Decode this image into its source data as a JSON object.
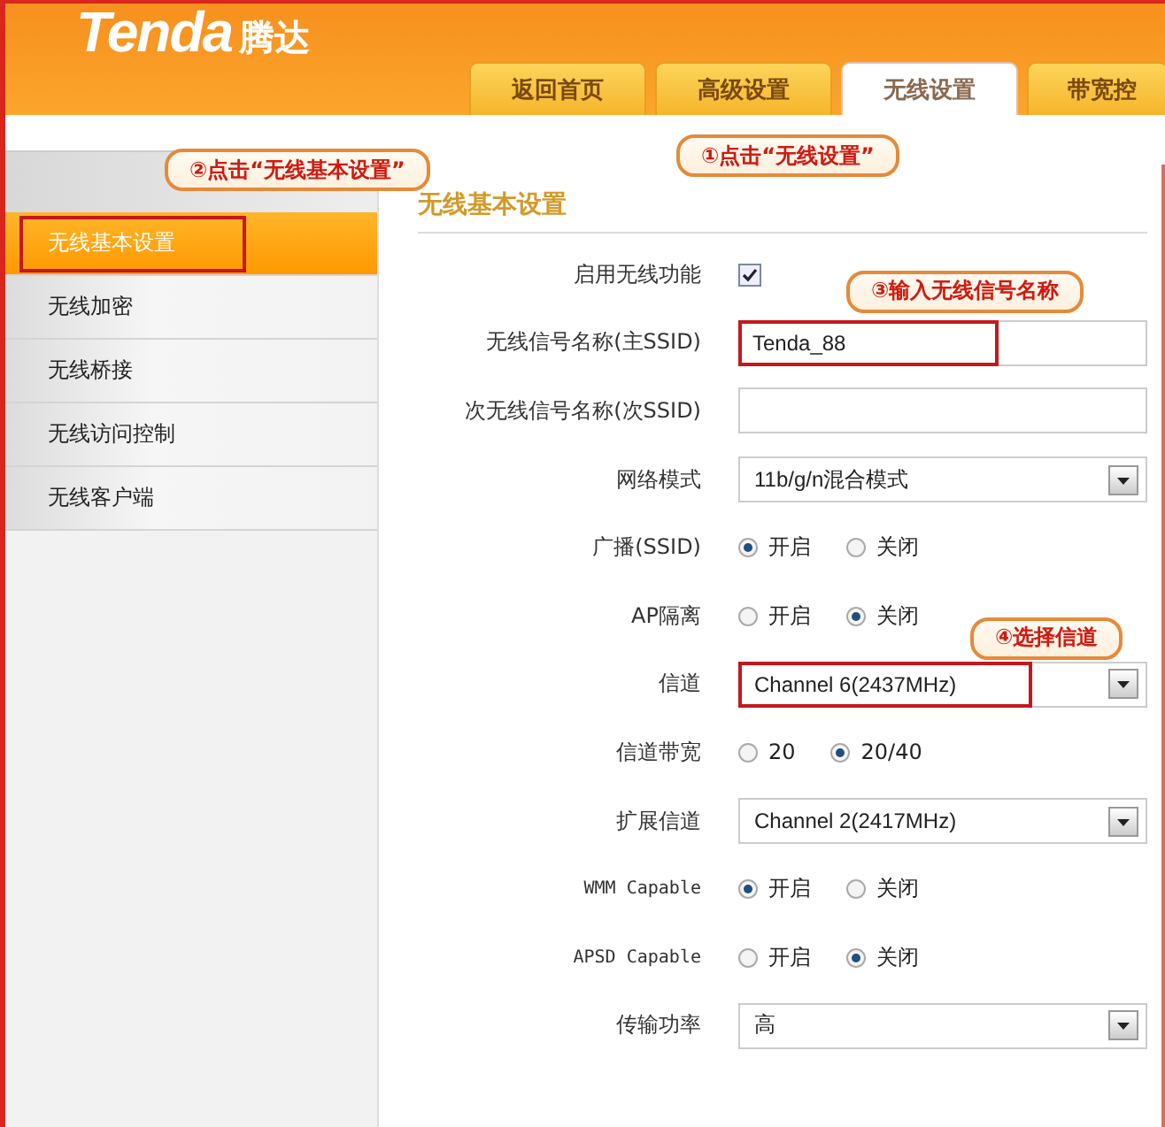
{
  "header": {
    "logo": "Tenda",
    "logo_cn": "腾达"
  },
  "tabs": [
    {
      "label": "返回首页",
      "selected": false
    },
    {
      "label": "高级设置",
      "selected": false
    },
    {
      "label": "无线设置",
      "selected": true,
      "callout": "①点击“无线设置”"
    },
    {
      "label": "带宽控",
      "selected": false
    }
  ],
  "sidebar": {
    "items": [
      {
        "label": "无线基本设置",
        "selected": true,
        "highlighted": true,
        "callout": "②点击“无线基本设置”"
      },
      {
        "label": "无线加密",
        "selected": false,
        "highlighted": false
      },
      {
        "label": "无线桥接",
        "selected": false,
        "highlighted": false
      },
      {
        "label": "无线访问控制",
        "selected": false,
        "highlighted": false
      },
      {
        "label": "无线客户端",
        "selected": false,
        "highlighted": false
      }
    ]
  },
  "form": {
    "title": "无线基本设置",
    "rows": [
      {
        "kind": "checkbox",
        "label": "启用无线功能",
        "checked": true
      },
      {
        "kind": "text",
        "label": "无线信号名称(主SSID)",
        "value": "Tenda_88",
        "highlighted": true,
        "callout": "③输入无线信号名称"
      },
      {
        "kind": "text",
        "label": "次无线信号名称(次SSID)",
        "highlighted": false
      },
      {
        "kind": "select",
        "label": "网络模式",
        "value": "11b/g/n混合模式",
        "highlighted": false
      },
      {
        "kind": "radio",
        "label": "广播(SSID)",
        "options": [
          {
            "label": "开启",
            "selected": true
          },
          {
            "label": "关闭",
            "selected": false
          }
        ]
      },
      {
        "kind": "radio",
        "label": "AP隔离",
        "options": [
          {
            "label": "开启",
            "selected": false
          },
          {
            "label": "关闭",
            "selected": true
          }
        ]
      },
      {
        "kind": "select",
        "label": "信道",
        "value": "Channel 6(2437MHz)",
        "highlighted": true,
        "callout": "④选择信道"
      },
      {
        "kind": "radio",
        "label": "信道带宽",
        "options": [
          {
            "label": "20",
            "selected": false
          },
          {
            "label": "20/40",
            "selected": true
          }
        ]
      },
      {
        "kind": "select",
        "label": "扩展信道",
        "value": "Channel 2(2417MHz)",
        "highlighted": false
      },
      {
        "kind": "radio",
        "label": "WMM Capable",
        "options": [
          {
            "label": "开启",
            "selected": true
          },
          {
            "label": "关闭",
            "selected": false
          }
        ]
      },
      {
        "kind": "radio",
        "label": "APSD Capable",
        "options": [
          {
            "label": "开启",
            "selected": false
          },
          {
            "label": "关闭",
            "selected": true
          }
        ]
      },
      {
        "kind": "select",
        "label": "传输功率",
        "value": "高",
        "highlighted": false
      }
    ]
  }
}
